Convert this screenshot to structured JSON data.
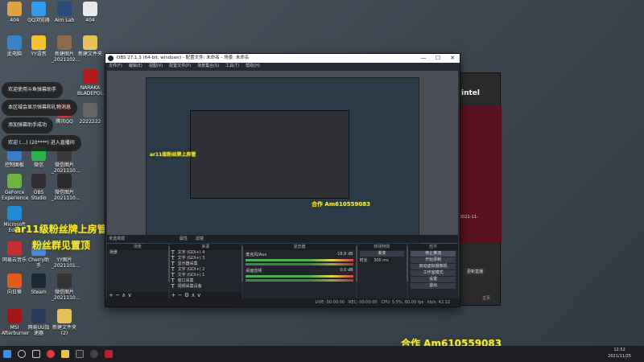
{
  "desktop": {
    "icons": [
      {
        "label": "404",
        "color": "#d9a441"
      },
      {
        "label": "QQ浏览器",
        "color": "#2f9cf0"
      },
      {
        "label": "Aim Lab",
        "color": "#2a4c7a"
      },
      {
        "label": "404",
        "color": "#e8e8e8"
      },
      {
        "label": "此电脑",
        "color": "#3b82c4"
      },
      {
        "label": "YY语音",
        "color": "#f4c430"
      },
      {
        "label": "新建图片_2021102...",
        "color": "#8c6a4f"
      },
      {
        "label": "新建文件夹",
        "color": "#e6c15a"
      },
      {
        "label": "NARAKA BLADEPOI...",
        "color": "#b31b1b"
      },
      {
        "label": "腾讯QQ",
        "color": "#d03030"
      },
      {
        "label": "2222222",
        "color": "#666666"
      },
      {
        "label": "控制面板",
        "color": "#3a7bc8"
      },
      {
        "label": "微信",
        "color": "#2ab34a"
      },
      {
        "label": "微信图片_2021110...",
        "color": "#3a3a3a"
      },
      {
        "label": "GeForce Experience",
        "color": "#6db33f"
      },
      {
        "label": "OBS Studio",
        "color": "#302e31"
      },
      {
        "label": "微信图片_2021110...",
        "color": "#2a2a2a"
      },
      {
        "label": "Microsoft Edge",
        "color": "#1f8bd6"
      },
      {
        "label": "网易云音乐",
        "color": "#c62f2f"
      },
      {
        "label": "Cherry助手",
        "color": "#4a8ad4"
      },
      {
        "label": "YY图片_2021101...",
        "color": "#444444"
      },
      {
        "label": "向日葵",
        "color": "#e35b1a"
      },
      {
        "label": "Steam",
        "color": "#1b2838"
      },
      {
        "label": "微信图片_2021110...",
        "color": "#333333"
      },
      {
        "label": "MSI Afterburner",
        "color": "#a31515"
      },
      {
        "label": "网易UU加速器",
        "color": "#2b3a5a"
      },
      {
        "label": "新建文件夹 (2)",
        "color": "#e6c15a"
      }
    ]
  },
  "notifications": [
    "欢迎使用斗鱼弹幕助手",
    "本区域会显示弹幕和礼物消息",
    "添加弹幕助手成功",
    "欢迎 (…) (20****) 进入直播间"
  ],
  "overlays": {
    "left_text_1": "ar11级粉丝牌上房管",
    "left_text_2": "粉丝群见置顶",
    "bottom_contact": "合作 Am610559083",
    "preview_contact": "合作 Am610559083",
    "nested_text": "ar11级粉丝牌上房管"
  },
  "bg_window": {
    "brand": "intel",
    "date_text": "2021-11-",
    "button": "更新直播",
    "footer": "主页"
  },
  "obs": {
    "title": "OBS 27.1.3 (64-bit, windows) - 配置文件: 未命名 - 场景: 未命名",
    "menu": [
      "文件(F)",
      "编辑(E)",
      "视图(V)",
      "配置文件(P)",
      "场景集合(S)",
      "工具(T)",
      "帮助(H)"
    ],
    "window_controls": {
      "minimize": "—",
      "maximize": "☐",
      "close": "✕"
    },
    "tabs": [
      "属性",
      "滤镜"
    ],
    "no_source_text": "未选择源",
    "docks": {
      "scenes": {
        "header": "场景",
        "items": [
          "场景"
        ]
      },
      "sources": {
        "header": "来源",
        "items": [
          "文字 (GDI+) 4",
          "文字 (GDI+) 3",
          "显示器采集",
          "文字 (GDI+) 2",
          "文字 (GDI+) 1",
          "窗口采集",
          "视频采集设备"
        ]
      },
      "mixer": {
        "header": "混音器",
        "channels": [
          {
            "name": "麦克风/Aux",
            "db": "-18.8 dB"
          },
          {
            "name": "桌面音频",
            "db": "0.0 dB"
          }
        ]
      },
      "transitions": {
        "header": "转场特效",
        "type": "渐变",
        "duration_label": "时长",
        "duration_value": "300 ms"
      },
      "controls": {
        "header": "控件",
        "buttons": [
          "停止推流",
          "开始录制",
          "启动虚拟摄像机",
          "工作室模式",
          "设置",
          "退出"
        ]
      }
    },
    "status": {
      "live": "LIVE: 00:00:00",
      "rec": "REC: 00:00:00",
      "cpu": "CPU: 5.5%, 60.00 fps",
      "bitrate": "kb/s: 42.32"
    }
  },
  "taskbar": {
    "time": "12:52",
    "date": "2021/11/25"
  }
}
